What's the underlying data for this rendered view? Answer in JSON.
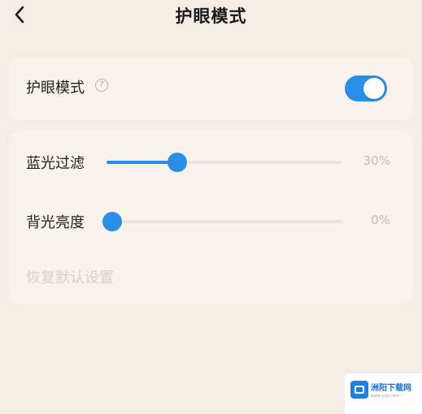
{
  "header": {
    "title": "护眼模式",
    "back_icon": "chevron-left-icon"
  },
  "eye_protection": {
    "label": "护眼模式",
    "help_icon": "question-circle-icon",
    "help_glyph": "?",
    "enabled": true
  },
  "sliders": {
    "blue_light": {
      "label": "蓝光过滤",
      "value_text": "30%",
      "level": 0.3
    },
    "backlight": {
      "label": "背光亮度",
      "value_text": "0%",
      "level": 0
    }
  },
  "reset": {
    "label": "恢复默认设置"
  },
  "watermark": {
    "text": "洲阳下载网",
    "subtext": "www.yzjy.com",
    "icon": "download-site-logo-icon"
  },
  "colors": {
    "background": "#f4ede6",
    "card": "#f8f2ec",
    "accent": "#2a8ee6",
    "track": "#ebe4dc",
    "muted_text": "#c4bdb6"
  }
}
